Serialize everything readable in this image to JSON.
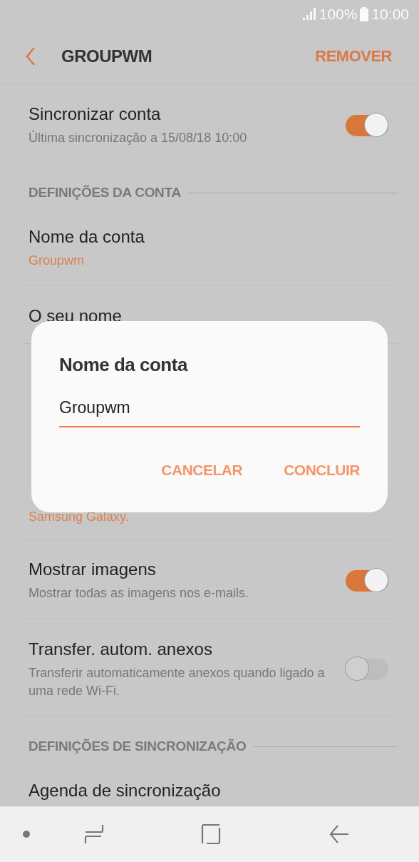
{
  "status_bar": {
    "battery": "100%",
    "time": "10:00"
  },
  "header": {
    "title": "GROUPWM",
    "action": "REMOVER"
  },
  "sync_row": {
    "title": "Sincronizar conta",
    "subtitle": "Última sincronização a 15/08/18  10:00",
    "on": true
  },
  "sections": [
    {
      "heading": "DEFINIÇÕES DA CONTA",
      "items": [
        {
          "title": "Nome da conta",
          "value": "Groupwm"
        },
        {
          "title": "O seu nome"
        },
        {
          "value": "Samsung Galaxy."
        },
        {
          "title": "Mostrar imagens",
          "subtitle": "Mostrar todas as imagens nos e-mails.",
          "on": true
        },
        {
          "title": "Transfer. autom. anexos",
          "subtitle": "Transferir automaticamente anexos quando ligado a uma rede Wi-Fi.",
          "on": false
        }
      ]
    },
    {
      "heading": "DEFINIÇÕES DE SINCRONIZAÇÃO",
      "items": [
        {
          "title": "Agenda de sincronização"
        }
      ]
    }
  ],
  "dialog": {
    "title": "Nome da conta",
    "value": "Groupwm",
    "buttons": [
      "CANCELAR",
      "CONCLUIR"
    ]
  }
}
